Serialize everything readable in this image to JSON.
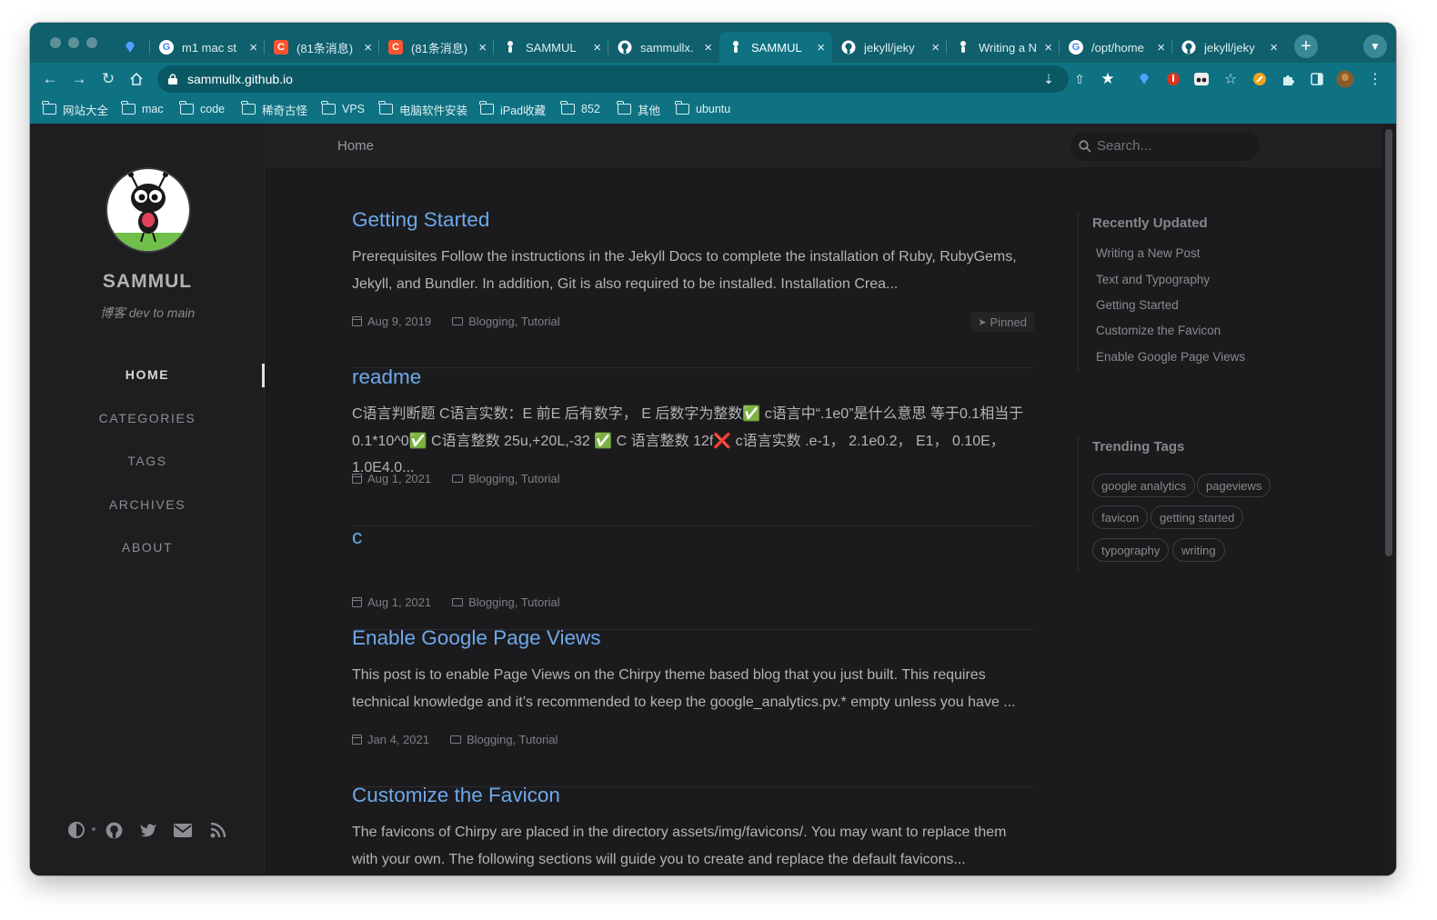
{
  "browser": {
    "tabs": [
      {
        "title": "",
        "favicon_icon": "gem-icon",
        "color": "#4da3ff"
      },
      {
        "title": "m1 mac st",
        "favicon_icon": "google-icon",
        "color": "#ffffff"
      },
      {
        "title": "(81条消息)",
        "favicon_icon": "csdn-icon",
        "color": "#fc5531"
      },
      {
        "title": "(81条消息)",
        "favicon_icon": "csdn-icon",
        "color": "#fc5531"
      },
      {
        "title": "SAMMUL",
        "favicon_icon": "ant-icon",
        "color": "#ffffff"
      },
      {
        "title": "sammullx.",
        "favicon_icon": "github-icon",
        "color": "#ffffff"
      },
      {
        "title": "SAMMUL",
        "favicon_icon": "ant-icon",
        "color": "#ffffff",
        "active": true
      },
      {
        "title": "jekyll/jeky",
        "favicon_icon": "github-icon",
        "color": "#ffffff"
      },
      {
        "title": "Writing a N",
        "favicon_icon": "ant-icon",
        "color": "#ffffff"
      },
      {
        "title": "/opt/home",
        "favicon_icon": "google-icon",
        "color": "#ffffff"
      },
      {
        "title": "jekyll/jeky",
        "favicon_icon": "github-icon",
        "color": "#ffffff"
      }
    ],
    "close_glyph": "×",
    "url": "sammullx.github.io",
    "bookmarks": [
      "网站大全",
      "mac",
      "code",
      "稀奇古怪",
      "VPS",
      "电脑软件安装",
      "iPad收藏",
      "852",
      "其他",
      "ubuntu"
    ],
    "accent": "#0e7283"
  },
  "sidebar": {
    "title": "SAMMUL",
    "subtitle": "博客 dev to main",
    "nav": [
      "HOME",
      "CATEGORIES",
      "TAGS",
      "ARCHIVES",
      "ABOUT"
    ],
    "active_nav": "HOME",
    "footer_icons": [
      "theme-toggle-icon",
      "github-icon",
      "twitter-icon",
      "email-icon",
      "rss-icon"
    ]
  },
  "topbar": {
    "breadcrumb": "Home",
    "search_placeholder": "Search..."
  },
  "posts": [
    {
      "title": "Getting Started",
      "excerpt": "Prerequisites Follow the instructions in the Jekyll Docs to complete the installation of Ruby, RubyGems, Jekyll, and Bundler. In addition, Git is also required to be installed. Installation Crea...",
      "date": "Aug 9, 2019",
      "categories": "Blogging, Tutorial",
      "pinned": "Pinned"
    },
    {
      "title": "readme",
      "excerpt": "C语言判断题 C语言实数：E 前E 后有数字， E 后数字为整数✅ c语言中“.1e0”是什么意思 等于0.1相当于0.1*10^0✅ C语言整数 25u,+20L,-32 ✅ C 语言整数 12f❌ c语言实数 .e-1， 2.1e0.2， E1， 0.10E， 1.0E4.0...",
      "date": "Aug 1, 2021",
      "categories": "Blogging, Tutorial"
    },
    {
      "title": "c",
      "excerpt": "",
      "date": "Aug 1, 2021",
      "categories": "Blogging, Tutorial"
    },
    {
      "title": "Enable Google Page Views",
      "excerpt": "This post is to enable Page Views on the Chirpy theme based blog that you just built. This requires technical knowledge and it’s recommended to keep the google_analytics.pv.* empty unless you have ...",
      "date": "Jan 4, 2021",
      "categories": "Blogging, Tutorial"
    },
    {
      "title": "Customize the Favicon",
      "excerpt": "The favicons of Chirpy are placed in the directory assets/img/favicons/. You may want to replace them with your own. The following sections will guide you to create and replace the default favicons...",
      "date": "",
      "categories": ""
    }
  ],
  "panel": {
    "recent_heading": "Recently Updated",
    "recent": [
      "Writing a New Post",
      "Text and Typography",
      "Getting Started",
      "Customize the Favicon",
      "Enable Google Page Views"
    ],
    "tags_heading": "Trending Tags",
    "tags": [
      "google analytics",
      "pageviews",
      "favicon",
      "getting started",
      "typography",
      "writing"
    ]
  },
  "colors": {
    "link": "#6ea8e8",
    "page_bg": "#1b1b1e",
    "sidebar_bg": "#1e1e21"
  }
}
